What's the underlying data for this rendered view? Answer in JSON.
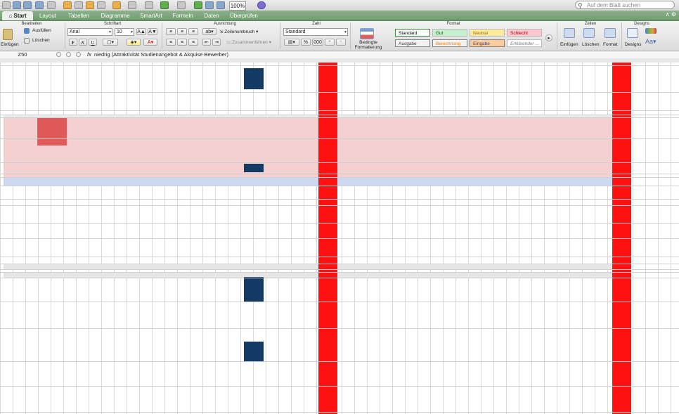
{
  "toolbar": {
    "zoom": "100%",
    "search_placeholder": "Auf dem Blatt suchen"
  },
  "tabs": [
    "Start",
    "Layout",
    "Tabellen",
    "Diagramme",
    "SmartArt",
    "Formeln",
    "Daten",
    "Überprüfen"
  ],
  "ribbon": {
    "groups": {
      "bearbeiten": "Bearbeiten",
      "schriftart": "Schriftart",
      "ausrichtung": "Ausrichtung",
      "zahl": "Zahl",
      "format": "Format",
      "zellen": "Zellen",
      "designs": "Designs"
    },
    "einfuegen": "Einfügen",
    "ausfuellen": "Ausfüllen",
    "loeschen": "Löschen",
    "font_name": "Arial",
    "font_size": "10",
    "zeilenumbruch": "Zeilenumbruch",
    "zusammenfuehren": "Zusammenführen",
    "number_format": "Standard",
    "bedingte_formatierung": "Bedingte Formatierung",
    "styles": [
      {
        "label": "Standard",
        "bg": "#ffffff",
        "fg": "#000000",
        "border": "#3b8d3b"
      },
      {
        "label": "Gut",
        "bg": "#c6efce",
        "fg": "#006100",
        "border": "#b9b9b9"
      },
      {
        "label": "Neutral",
        "bg": "#ffeb9c",
        "fg": "#9c6500",
        "border": "#b9b9b9"
      },
      {
        "label": "Schlecht",
        "bg": "#ffc7ce",
        "fg": "#9c0006",
        "border": "#b9b9b9"
      },
      {
        "label": "Ausgabe",
        "bg": "#f2f2f2",
        "fg": "#3f3f3f",
        "border": "#7f7f7f"
      },
      {
        "label": "Berechnung",
        "bg": "#f2f2f2",
        "fg": "#fa7d00",
        "border": "#7f7f7f"
      },
      {
        "label": "Eingabe",
        "bg": "#ffcc99",
        "fg": "#3f3f76",
        "border": "#7f7f7f"
      },
      {
        "label": "Erklärender ...",
        "bg": "#ffffff",
        "fg": "#7f7f7f",
        "border": "#b9b9b9"
      }
    ],
    "cells_buttons": [
      "Einfügen",
      "Löschen",
      "Format"
    ],
    "designs_button": "Designs",
    "font_buttons": {
      "bold": "F",
      "italic": "K",
      "underline": "U",
      "grow": "A▲",
      "shrink": "A▼"
    },
    "number_buttons": {
      "percent": "%",
      "thousands": "000"
    }
  },
  "formula_bar": {
    "cell_ref": "Z50",
    "fx": "fx",
    "content": "niedrig (Attraktivität Studienangebot & Akquise Bewerber)"
  },
  "colors": {
    "ribbon_tab_green": "#7aa67a",
    "red_column": "#ff1111",
    "pink_band": "#f5d0d0",
    "blue_band": "#ccd9f0",
    "navy_cell": "#133a63"
  }
}
